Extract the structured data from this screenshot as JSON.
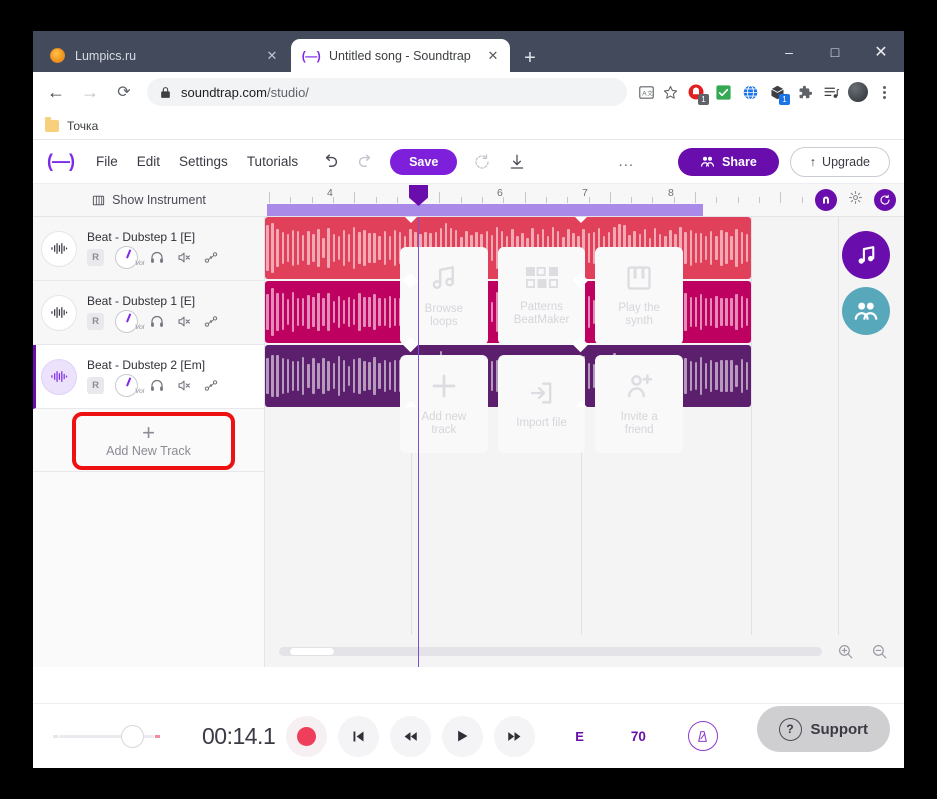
{
  "browser": {
    "tabs": [
      {
        "title": "Lumpics.ru",
        "favicon": "orange-circle-icon",
        "active": false
      },
      {
        "title": "Untitled song - Soundtrap",
        "favicon": "soundtrap-logo-icon",
        "active": true
      }
    ],
    "new_tab_label": "+",
    "window_controls": {
      "minimize": "–",
      "maximize": "□",
      "close": "✕"
    },
    "nav": {
      "back": "←",
      "forward": "→",
      "reload": "⟳"
    },
    "url": {
      "scheme_lock": "lock-icon",
      "domain": "soundtrap.com",
      "path": "/studio/"
    },
    "omnibox_icons": [
      "translate-icon",
      "bookmark-star-icon"
    ],
    "extension_icons": [
      {
        "name": "adblock-icon",
        "badge": "1",
        "badge_color": "#5f6368"
      },
      {
        "name": "checkmark-icon",
        "badge": ""
      },
      {
        "name": "globe-icon",
        "badge": ""
      },
      {
        "name": "package-icon",
        "badge": "1",
        "badge_color": "#1a73e8"
      },
      {
        "name": "puzzle-icon",
        "badge": ""
      },
      {
        "name": "media-list-icon",
        "badge": ""
      }
    ],
    "profile_avatar": "avatar",
    "menu": "kebab-menu-icon",
    "bookmarks": [
      {
        "label": "Точка",
        "icon": "folder-icon"
      }
    ]
  },
  "app": {
    "logo": "(—)",
    "menus": [
      "File",
      "Edit",
      "Settings",
      "Tutorials"
    ],
    "undo_icon": "undo-icon",
    "redo_icon": "redo-icon",
    "save_label": "Save",
    "loop_icon": "revert-icon",
    "download_icon": "download-icon",
    "overflow": "...",
    "share_label": "Share",
    "upgrade_label": "Upgrade",
    "show_instrument_label": "Show Instrument",
    "ruler_marks": [
      "4",
      "6",
      "7",
      "8"
    ],
    "right_controls": [
      "magnet-snap-icon",
      "gear-icon",
      "loop-region-icon"
    ],
    "fab_buttons": [
      "music-note-icon",
      "collaborate-icon"
    ]
  },
  "tracks": [
    {
      "name": "Beat - Dubstep 1 [E]",
      "record_label": "R",
      "vol_label": "Vol",
      "icons": [
        "waveform-icon",
        "headphones-icon",
        "mute-icon",
        "automation-icon"
      ],
      "selected": false,
      "clip_color": "#E0405A"
    },
    {
      "name": "Beat - Dubstep 1 [E]",
      "record_label": "R",
      "vol_label": "Vol",
      "icons": [
        "waveform-icon",
        "headphones-icon",
        "mute-icon",
        "automation-icon"
      ],
      "selected": false,
      "clip_color": "#BE0060"
    },
    {
      "name": "Beat - Dubstep 2 [Em]",
      "record_label": "R",
      "vol_label": "Vol",
      "icons": [
        "waveform-icon",
        "headphones-icon",
        "mute-icon",
        "automation-icon"
      ],
      "selected": true,
      "clip_color": "#5B1F6E"
    }
  ],
  "add_track": {
    "label": "Add New Track",
    "plus": "+",
    "highlighted": true,
    "highlight_color": "#ee1111"
  },
  "quick_tiles": [
    {
      "label": "Browse\nloops",
      "line1": "Browse",
      "line2": "loops",
      "icon": "music-note-icon"
    },
    {
      "label": "Patterns BeatMaker",
      "line1": "Patterns",
      "line2": "BeatMaker",
      "icon": "beatmaker-grid-icon"
    },
    {
      "label": "Play the synth",
      "line1": "Play the",
      "line2": "synth",
      "icon": "piano-keys-icon"
    },
    {
      "label": "Add new track",
      "line1": "Add new",
      "line2": "track",
      "icon": "plus-icon"
    },
    {
      "label": "Import file",
      "line1": "Import file",
      "line2": "",
      "icon": "import-arrow-icon"
    },
    {
      "label": "Invite a friend",
      "line1": "Invite a",
      "line2": "friend",
      "icon": "invite-person-icon"
    }
  ],
  "zoom_controls": {
    "zoom_in": "zoom-in-icon",
    "zoom_out": "zoom-out-icon"
  },
  "transport": {
    "volume_icon": "volume-slider",
    "timecode": "00:14.1",
    "record": "record-icon",
    "to_start": "skip-to-start-icon",
    "rewind": "rewind-icon",
    "play": "play-icon",
    "forward": "fast-forward-icon",
    "key": "E",
    "bpm": "70",
    "metronome": "metronome-icon"
  },
  "support_widget": {
    "label": "Support",
    "icon": "question-mark-icon"
  }
}
